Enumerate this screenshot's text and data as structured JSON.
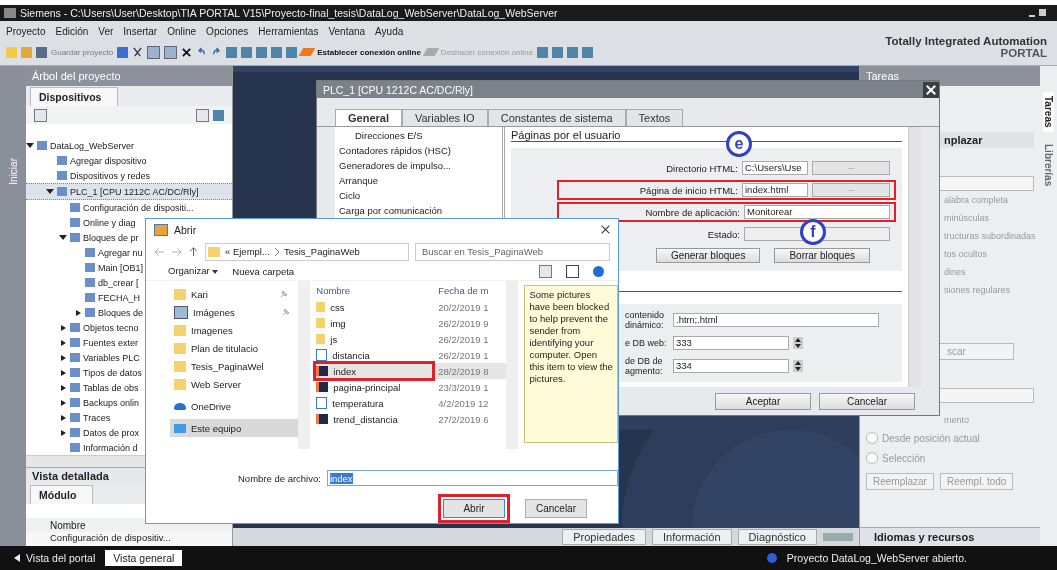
{
  "window": {
    "title": "Siemens  -  C:\\Users\\User\\Desktop\\TIA PORTAL V15\\Proyecto-final_tesis\\DataLog_WebServer\\DataLog_WebServer"
  },
  "menu": [
    "Proyecto",
    "Edición",
    "Ver",
    "Insertar",
    "Online",
    "Opciones",
    "Herramientas",
    "Ventana",
    "Ayuda"
  ],
  "toolbar": {
    "save": "Guardar proyecto",
    "connect": "Establecer conexión online",
    "disconnect": "Deshacer conexión online"
  },
  "brand": {
    "line1": "Totally Integrated Automation",
    "line2": "PORTAL"
  },
  "start_tab": "Iniciar",
  "project_tree": {
    "title": "Árbol del proyecto",
    "tab": "Dispositivos",
    "items": [
      {
        "label": "DataLog_WebServer",
        "expanded": true,
        "selected": false,
        "children": [
          {
            "label": "Agregar dispositivo",
            "selected": false
          },
          {
            "label": "Dispositivos y redes",
            "selected": false
          },
          {
            "label": "PLC_1 [CPU 1212C AC/DC/Rly]",
            "expanded": true,
            "selected": true,
            "children": [
              {
                "label": "Configuración de dispositi...",
                "selected": false
              },
              {
                "label": "Online y diag",
                "selected": false
              },
              {
                "label": "Bloques de pr",
                "expanded": true,
                "selected": false,
                "children": [
                  {
                    "label": "Agregar nu",
                    "selected": false
                  },
                  {
                    "label": "Main [OB1]",
                    "selected": false
                  },
                  {
                    "label": "db_crear [",
                    "selected": false
                  },
                  {
                    "label": "FECHA_H",
                    "selected": false
                  },
                  {
                    "label": "Bloques de",
                    "expanded": false,
                    "selected": false
                  }
                ]
              },
              {
                "label": "Objetos tecno",
                "expanded": false,
                "selected": false
              },
              {
                "label": "Fuentes exter",
                "expanded": false,
                "selected": false
              },
              {
                "label": "Variables PLC",
                "expanded": false,
                "selected": false
              },
              {
                "label": "Tipos de datos",
                "expanded": false,
                "selected": false
              },
              {
                "label": "Tablas de obs",
                "expanded": false,
                "selected": false
              },
              {
                "label": "Backups onlin",
                "expanded": false,
                "selected": false
              },
              {
                "label": "Traces",
                "expanded": false,
                "selected": false
              },
              {
                "label": "Datos de prox",
                "expanded": false,
                "selected": false
              },
              {
                "label": "Información d",
                "selected": false
              }
            ]
          }
        ]
      }
    ]
  },
  "detail_view": {
    "title": "Vista detallada",
    "tab": "Módulo",
    "column": "Nombre",
    "rows": [
      "Configuración de dispositiv..."
    ]
  },
  "tasks": {
    "title": "Tareas",
    "section": "nplazar",
    "options": [
      "alabra completa",
      "minúsculas",
      "tructuras subordinadas",
      "tos ocultos",
      "dines",
      "siones regulares"
    ],
    "search_button": "scar",
    "direction_label": "mento",
    "radios": [
      {
        "label": "Desde posición actual",
        "selected": false
      },
      {
        "label": "Selección",
        "selected": false
      }
    ],
    "buttons": [
      "Reemplazar",
      "Reempl. todo"
    ],
    "footer": "Idiomas y recursos"
  },
  "side_tabs": [
    {
      "label": "Tareas",
      "selected": true
    },
    {
      "label": "Librerías",
      "selected": false
    }
  ],
  "inspector_tabs": [
    "Propiedades",
    "Información",
    "Diagnóstico"
  ],
  "status_bar": {
    "portal": "Vista del portal",
    "overview": "Vista general",
    "message": "Proyecto DataLog_WebServer abierto."
  },
  "plc_dialog": {
    "title": "PLC_1 [CPU 1212C AC/DC/Rly]",
    "tabs": [
      {
        "label": "General",
        "selected": true
      },
      {
        "label": "Variables IO",
        "selected": false
      },
      {
        "label": "Constantes de sistema",
        "selected": false
      },
      {
        "label": "Textos",
        "selected": false
      }
    ],
    "nav": [
      "Direcciones E/S",
      "Contadores rápidos (HSC)",
      "Generadores de impulso...",
      "Arranque",
      "Ciclo",
      "Carga por comunicación"
    ],
    "section": "Páginas por el usuario",
    "fields": [
      {
        "label": "Directorio HTML:",
        "value": "C:\\Users\\Use",
        "browse": "...",
        "highlighted": false
      },
      {
        "label": "Página de inicio HTML:",
        "value": "index.html",
        "browse": "...",
        "highlighted": true
      },
      {
        "label": "Nombre de aplicación:",
        "value": "Monitorear",
        "highlighted": true
      },
      {
        "label": "Estado:",
        "highlighted": false
      }
    ],
    "block_buttons": [
      "Generar bloques",
      "Borrar bloques"
    ],
    "lower_fields": [
      {
        "label": "contenido dinámico:",
        "value": ".htm;.html",
        "kind": "text"
      },
      {
        "label": "e DB web:",
        "value": "333",
        "kind": "spin"
      },
      {
        "label": "de DB de agmento:",
        "value": "334",
        "kind": "spin"
      }
    ],
    "buttons": [
      "Aceptar",
      "Cancelar"
    ]
  },
  "annotations": [
    {
      "label": "e"
    },
    {
      "label": "f"
    }
  ],
  "open_dialog": {
    "title": "Abrir",
    "path": [
      "« Ejempl...",
      "Tesis_PaginaWeb"
    ],
    "search_placeholder": "Buscar en Tesis_PaginaWeb",
    "commands": [
      "Organizar",
      "Nueva carpeta"
    ],
    "nav": [
      {
        "label": "Kari",
        "kind": "folder",
        "pinned": true,
        "selected": false
      },
      {
        "label": "Imágenes",
        "kind": "pictures",
        "pinned": true,
        "selected": false
      },
      {
        "label": "Imagenes",
        "kind": "folder",
        "pinned": false,
        "selected": false
      },
      {
        "label": "Plan de titulacio",
        "kind": "folder",
        "pinned": false,
        "selected": false
      },
      {
        "label": "Tesis_PaginaWel",
        "kind": "folder",
        "pinned": false,
        "selected": false
      },
      {
        "label": "Web Server",
        "kind": "folder",
        "pinned": false,
        "selected": false
      },
      {
        "label": "OneDrive",
        "kind": "cloud",
        "pinned": false,
        "selected": false
      },
      {
        "label": "Este equipo",
        "kind": "computer",
        "pinned": false,
        "selected": true
      }
    ],
    "columns": [
      "Nombre",
      "Fecha de m"
    ],
    "files": [
      {
        "name": "css",
        "date": "20/2/2019 1",
        "kind": "folder",
        "selected": false,
        "highlighted": false
      },
      {
        "name": "img",
        "date": "26/2/2019 9",
        "kind": "folder",
        "selected": false,
        "highlighted": false
      },
      {
        "name": "js",
        "date": "26/2/2019 1",
        "kind": "folder",
        "selected": false,
        "highlighted": false
      },
      {
        "name": "distancia",
        "date": "26/2/2019 1",
        "kind": "web",
        "selected": false,
        "highlighted": false
      },
      {
        "name": "index",
        "date": "28/2/2019 8",
        "kind": "html",
        "selected": true,
        "highlighted": true
      },
      {
        "name": "pagina-principal",
        "date": "23/3/2019 1",
        "kind": "html",
        "selected": false,
        "highlighted": false
      },
      {
        "name": "temperatura",
        "date": "4/2/2019 12",
        "kind": "web",
        "selected": false,
        "highlighted": false
      },
      {
        "name": "trend_distancia",
        "date": "27/2/2019 6",
        "kind": "html",
        "selected": false,
        "highlighted": false
      }
    ],
    "preview": "Some pictures have been blocked to help prevent the sender from identifying your computer. Open this item to view the pictures.",
    "filename_label": "Nombre de archivo:",
    "filename": "index",
    "buttons": [
      {
        "label": "Abrir",
        "highlighted": true
      },
      {
        "label": "Cancelar",
        "highlighted": false
      }
    ]
  }
}
